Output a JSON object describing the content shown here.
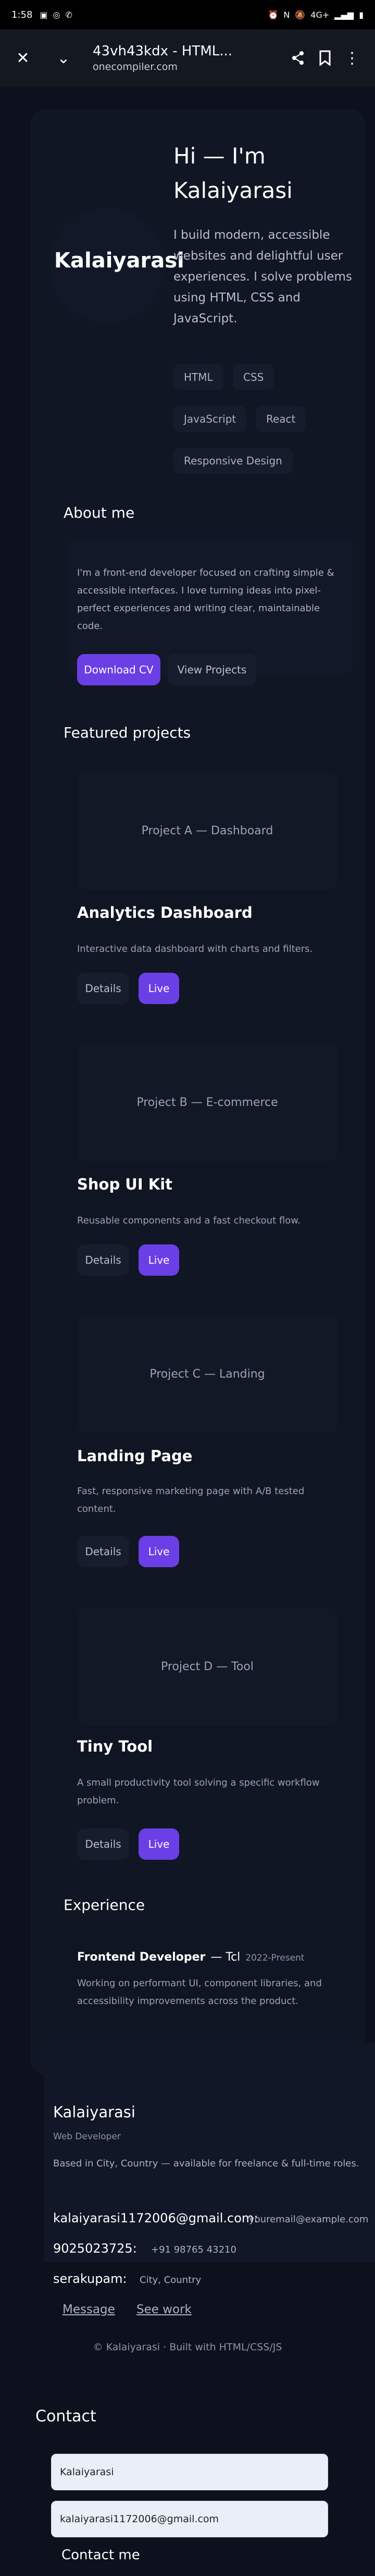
{
  "statusbar": {
    "time": "1:58",
    "network": "4G+"
  },
  "browser": {
    "title": "43vh43kdx - HTML...",
    "host": "onecompiler.com"
  },
  "hero": {
    "name_big": "Kalaiyarasi",
    "title": "Hi — I'm Kalaiyarasi",
    "description": "I build modern, accessible websites and delightful user experiences. I solve problems using HTML, CSS and JavaScript.",
    "skills": [
      "HTML",
      "CSS",
      "JavaScript",
      "React",
      "Responsive Design"
    ]
  },
  "about": {
    "heading": "About me",
    "text": "I'm a front-end developer focused on crafting simple & accessible interfaces. I love turning ideas into pixel-perfect experiences and writing clear, maintainable code.",
    "download_label": "Download CV",
    "view_projects_label": "View Projects"
  },
  "projects": {
    "heading": "Featured projects",
    "items": [
      {
        "thumb": "Project A — Dashboard",
        "title": "Analytics Dashboard",
        "desc": "Interactive data dashboard with charts and filters.",
        "details": "Details",
        "live": "Live"
      },
      {
        "thumb": "Project B — E-commerce",
        "title": "Shop UI Kit",
        "desc": "Reusable components and a fast checkout flow.",
        "details": "Details",
        "live": "Live"
      },
      {
        "thumb": "Project C — Landing",
        "title": "Landing Page",
        "desc": "Fast, responsive marketing page with A/B tested content.",
        "details": "Details",
        "live": "Live"
      },
      {
        "thumb": "Project D — Tool",
        "title": "Tiny Tool",
        "desc": "A small productivity tool solving a specific workflow problem.",
        "details": "Details",
        "live": "Live"
      }
    ]
  },
  "experience": {
    "heading": "Experience",
    "role": "Frontend Developer",
    "company": "— Tcl",
    "dates": "2022-Present",
    "desc": "Working on performant UI, component libraries, and accessibility improvements across the product."
  },
  "footer": {
    "name": "Kalaiyarasi",
    "role": "Web Developer",
    "based": "Based in City, Country — available for freelance & full-time roles.",
    "email_key": "kalaiyarasi1172006@gmail.com:",
    "email_val": "youremail@example.com",
    "phone_key": "9025023725:",
    "phone_val": "+91 98765 43210",
    "location_key": "serakupam:",
    "location_val": "City, Country",
    "link_message": "Message",
    "link_work": "See work",
    "copyright": "© Kalaiyarasi · Built with HTML/CSS/JS"
  },
  "contact": {
    "heading": "Contact",
    "name_value": "Kalaiyarasi",
    "email_value": "kalaiyarasi1172006@gmail.com",
    "message_label": "Contact me"
  }
}
